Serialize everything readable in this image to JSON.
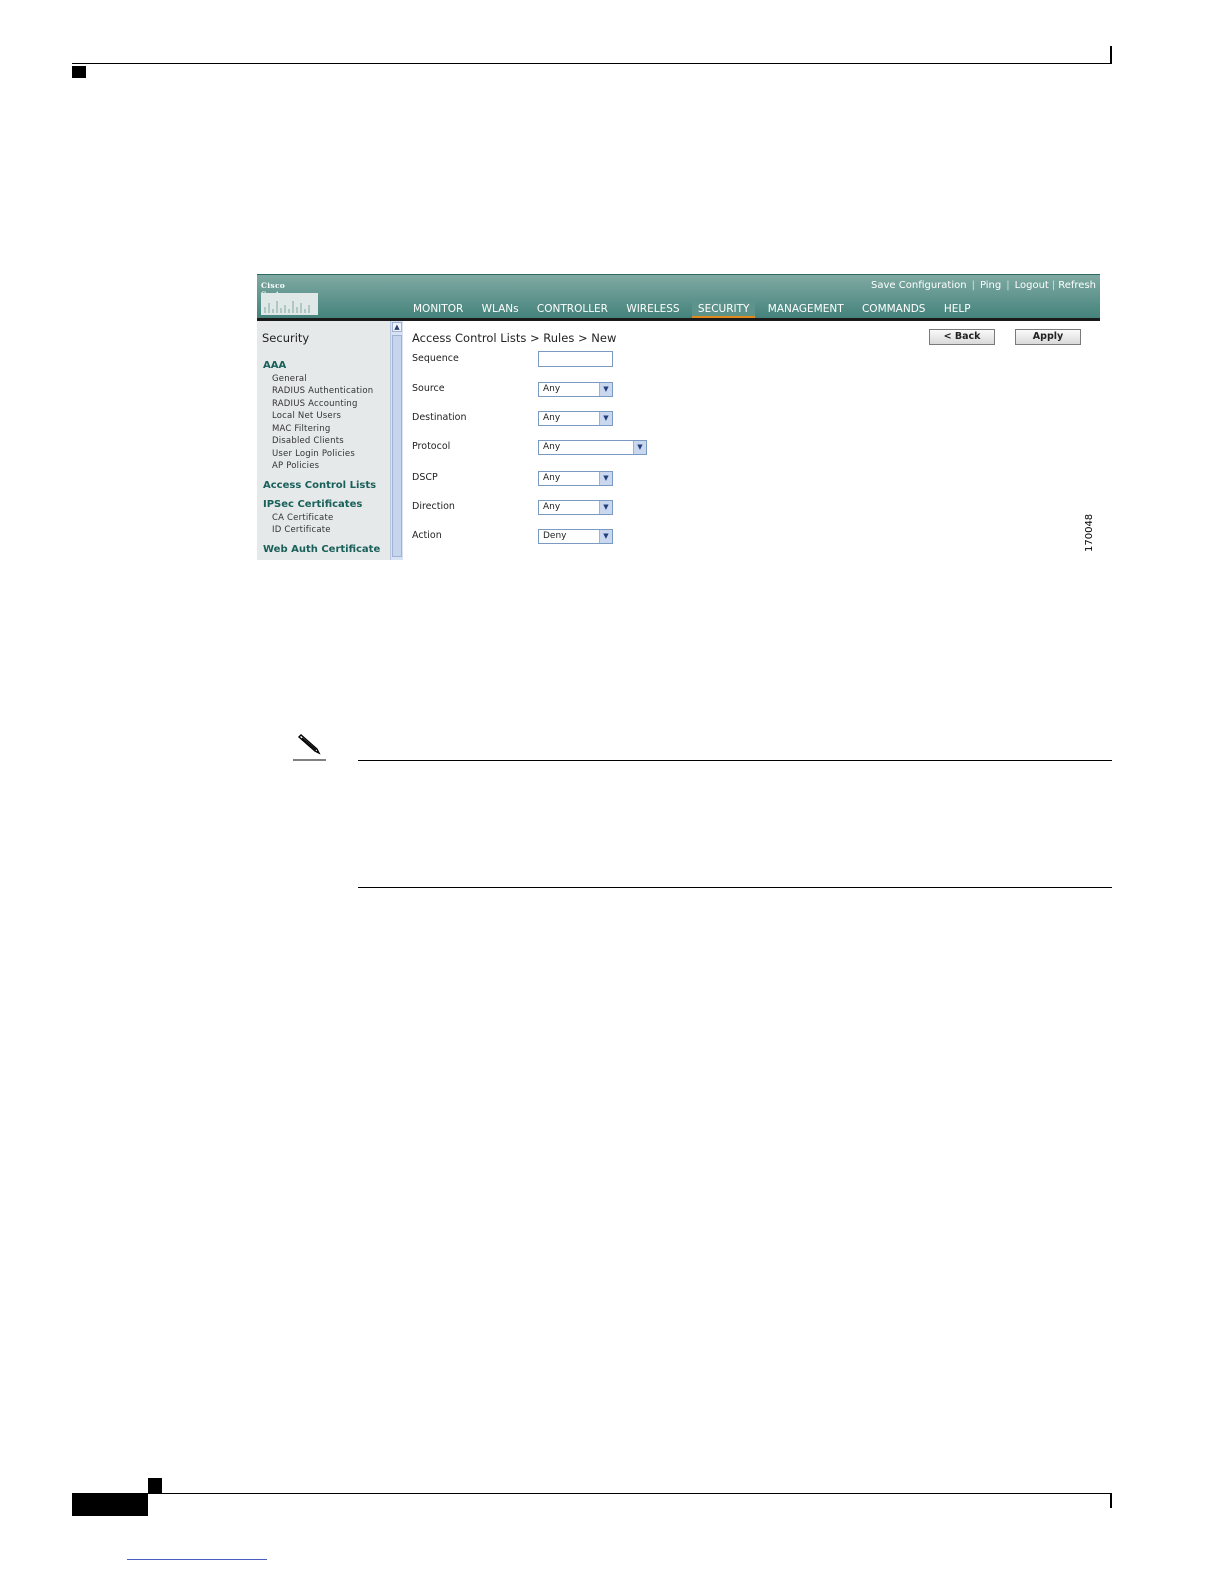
{
  "figure": {
    "logo_text": "Cisco Systems",
    "top_links": [
      "Save Configuration",
      "Ping",
      "Logout",
      "Refresh"
    ],
    "nav": [
      "MONITOR",
      "WLANs",
      "CONTROLLER",
      "WIRELESS",
      "SECURITY",
      "MANAGEMENT",
      "COMMANDS",
      "HELP"
    ],
    "nav_active": "SECURITY",
    "sidebar": {
      "title": "Security",
      "aaa": "AAA",
      "aaa_items": [
        "General",
        "RADIUS Authentication",
        "RADIUS Accounting",
        "Local Net Users",
        "MAC Filtering",
        "Disabled Clients",
        "User Login Policies",
        "AP Policies"
      ],
      "acl": "Access Control Lists",
      "ipsec": "IPSec Certificates",
      "ipsec_items": [
        "CA Certificate",
        "ID Certificate"
      ],
      "webauth": "Web Auth Certificate"
    },
    "breadcrumb": "Access Control Lists > Rules > New",
    "back_button": "< Back",
    "apply_button": "Apply",
    "fields": {
      "sequence": {
        "label": "Sequence",
        "value": ""
      },
      "source": {
        "label": "Source",
        "value": "Any"
      },
      "destination": {
        "label": "Destination",
        "value": "Any"
      },
      "protocol": {
        "label": "Protocol",
        "value": "Any"
      },
      "dscp": {
        "label": "DSCP",
        "value": "Any"
      },
      "direction": {
        "label": "Direction",
        "value": "Any"
      },
      "action": {
        "label": "Action",
        "value": "Deny"
      }
    },
    "figure_id": "170048"
  },
  "colors": {
    "header": "#3f7f78",
    "nav_active_underline": "#e08a1e",
    "sidebar_group": "#19605a"
  }
}
